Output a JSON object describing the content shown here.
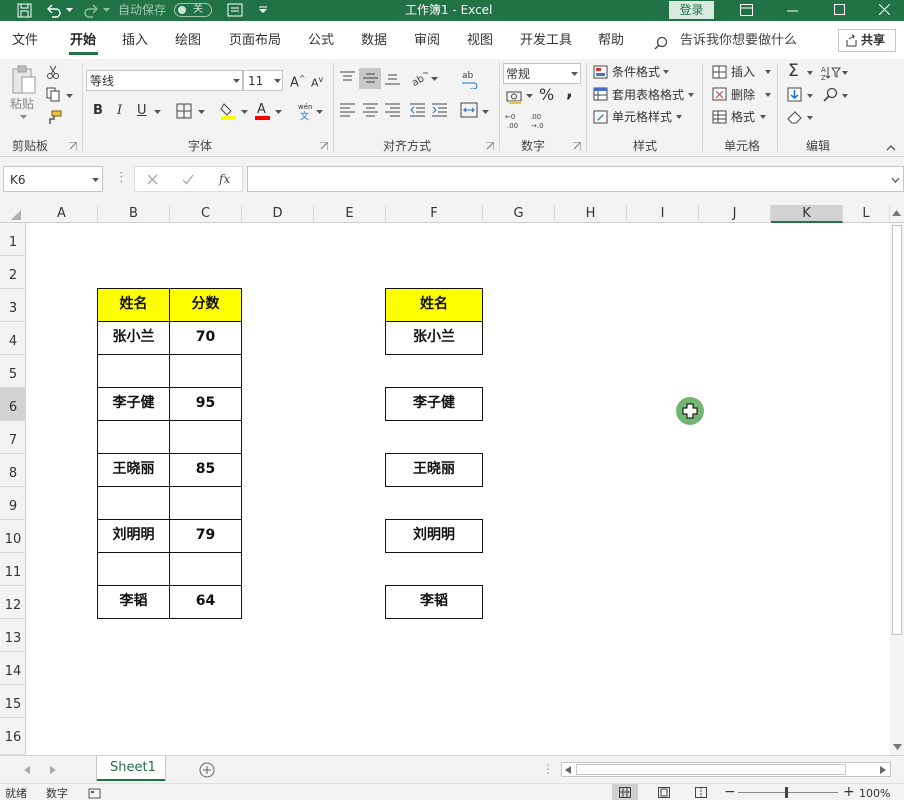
{
  "title_bar": {
    "autosave_label": "自动保存",
    "autosave_state": "关",
    "title": "工作簿1 - Excel",
    "login_label": "登录"
  },
  "tabs": [
    {
      "label": "文件"
    },
    {
      "label": "开始"
    },
    {
      "label": "插入"
    },
    {
      "label": "绘图"
    },
    {
      "label": "页面布局"
    },
    {
      "label": "公式"
    },
    {
      "label": "数据"
    },
    {
      "label": "审阅"
    },
    {
      "label": "视图"
    },
    {
      "label": "开发工具"
    },
    {
      "label": "帮助"
    }
  ],
  "tell_me": "告诉我你想要做什么",
  "share_label": "共享",
  "ribbon": {
    "clipboard": {
      "paste_label": "粘贴",
      "group_label": "剪贴板"
    },
    "font": {
      "font_name": "等线",
      "font_size": "11",
      "group_label": "字体",
      "bold": "B",
      "italic": "I",
      "underline": "U"
    },
    "alignment": {
      "group_label": "对齐方式"
    },
    "number": {
      "format": "常规",
      "group_label": "数字"
    },
    "styles": {
      "conditional": "条件格式",
      "table": "套用表格格式",
      "cell_styles": "单元格样式",
      "group_label": "样式"
    },
    "cells": {
      "insert": "插入",
      "delete": "删除",
      "format": "格式",
      "group_label": "单元格"
    },
    "editing": {
      "group_label": "编辑"
    }
  },
  "formula_bar": {
    "name_box": "K6",
    "fx": "fx",
    "formula": ""
  },
  "columns": [
    "A",
    "B",
    "C",
    "D",
    "E",
    "F",
    "G",
    "H",
    "I",
    "J",
    "K",
    "L"
  ],
  "selected_column": "K",
  "rows": [
    "1",
    "2",
    "3",
    "4",
    "5",
    "6",
    "7",
    "8",
    "9",
    "10",
    "11",
    "12",
    "13",
    "14",
    "15",
    "16"
  ],
  "selected_row": "6",
  "table_left": {
    "headers": [
      "姓名",
      "分数"
    ],
    "rows": [
      [
        "张小兰",
        "70"
      ],
      [
        "",
        ""
      ],
      [
        "李子健",
        "95"
      ],
      [
        "",
        ""
      ],
      [
        "王晓丽",
        "85"
      ],
      [
        "",
        ""
      ],
      [
        "刘明明",
        "79"
      ],
      [
        "",
        ""
      ],
      [
        "李韬",
        "64"
      ]
    ]
  },
  "table_right": {
    "header": "姓名",
    "names": [
      "张小兰",
      "李子健",
      "王晓丽",
      "刘明明",
      "李韬"
    ]
  },
  "sheet_tabs": [
    {
      "label": "Sheet1"
    }
  ],
  "status": {
    "ready": "就绪",
    "mode": "数字",
    "zoom": "100%"
  },
  "colors": {
    "excel_green": "#217346",
    "header_fill": "#ffff00"
  }
}
